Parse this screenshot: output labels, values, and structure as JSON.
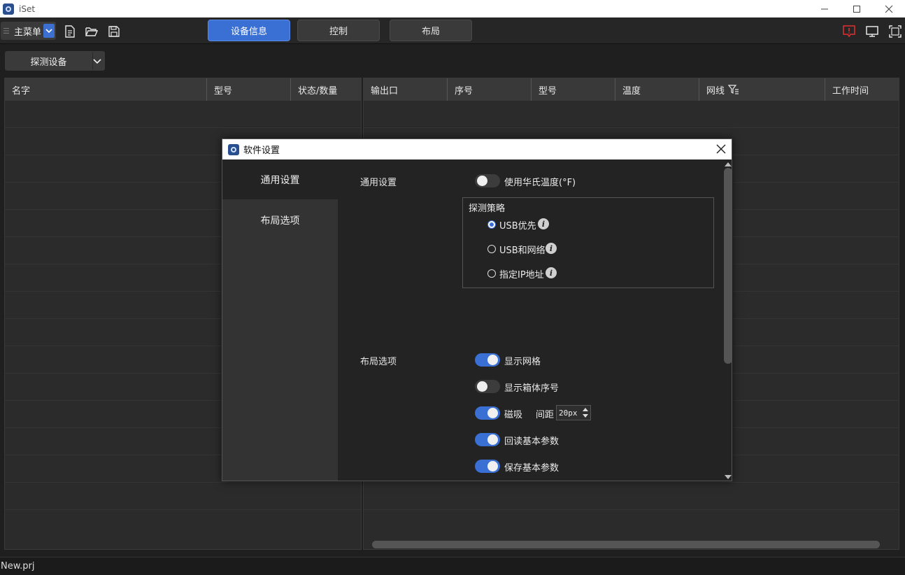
{
  "window": {
    "title": "iSet"
  },
  "toolbar": {
    "main_menu_label": "主菜单",
    "tabs": [
      {
        "label": "设备信息",
        "active": true
      },
      {
        "label": "控制",
        "active": false
      },
      {
        "label": "布局",
        "active": false
      }
    ]
  },
  "detect_button": {
    "label": "探测设备"
  },
  "left_table": {
    "columns": [
      "名字",
      "型号",
      "状态/数量"
    ]
  },
  "right_table": {
    "columns": [
      "输出口",
      "序号",
      "型号",
      "温度",
      "网线",
      "工作时间"
    ]
  },
  "statusbar": {
    "text": "New.prj"
  },
  "dialog": {
    "title": "软件设置",
    "sidebar": [
      {
        "label": "通用设置",
        "active": true
      },
      {
        "label": "布局选项",
        "active": false
      }
    ],
    "general": {
      "section_label": "通用设置",
      "fahrenheit": {
        "label": "使用华氏温度(°F)",
        "on": false
      },
      "detect_strategy": {
        "title": "探测策略",
        "options": [
          {
            "label": "USB优先",
            "selected": true
          },
          {
            "label": "USB和网络",
            "selected": false
          },
          {
            "label": "指定IP地址",
            "selected": false
          }
        ]
      }
    },
    "layout": {
      "section_label": "布局选项",
      "show_grid": {
        "label": "显示网格",
        "on": true
      },
      "show_box_index": {
        "label": "显示箱体序号",
        "on": false
      },
      "snap": {
        "label": "磁吸",
        "on": true,
        "spacing_label": "间距",
        "spacing_value": "20px"
      },
      "read_back": {
        "label": "回读基本参数",
        "on": true
      },
      "save_params": {
        "label": "保存基本参数",
        "on": true
      }
    }
  },
  "colors": {
    "accent": "#3a6fd4",
    "background": "#1f1f1f",
    "alert": "#e03030"
  }
}
